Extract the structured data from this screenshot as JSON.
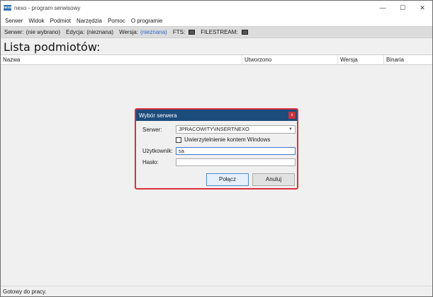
{
  "window": {
    "title": "nexo - program serwisowy",
    "icon_text": "nexo",
    "controls": [
      "—",
      "☐",
      "✕"
    ]
  },
  "menu": [
    "Serwer",
    "Widok",
    "Podmiot",
    "Narzędzia",
    "Pomoc",
    "O programie"
  ],
  "infobar": {
    "server_label": "Serwer:",
    "server_value": "(nie wybrano)",
    "edition_label": "Edycja:",
    "edition_value": "(nieznana)",
    "version_label": "Wersja:",
    "version_value": "(nieznana)",
    "fts_label": "FTS:",
    "filestream_label": "FILESTREAM:"
  },
  "page_title": "Lista podmiotów:",
  "grid": {
    "columns": [
      "Nazwa",
      "Utworzono",
      "Wersja",
      "Binaria"
    ]
  },
  "status": "Gotowy do pracy.",
  "dialog": {
    "title": "Wybór serwera",
    "close": "x",
    "server_label": "Serwer:",
    "server_value": "JPRACOWITY\\INSERTNEXO",
    "windows_auth_label": "Uwierzytelnienie kontem Windows",
    "windows_auth_checked": false,
    "user_label": "Użytkownik:",
    "user_value": "sa",
    "password_label": "Hasło:",
    "password_value": "",
    "connect_label": "Połącz",
    "cancel_label": "Anuluj"
  },
  "colors": {
    "dialog_title_bg": "#1c4c7c",
    "dialog_border": "#d9303b",
    "link": "#2a66c7"
  }
}
